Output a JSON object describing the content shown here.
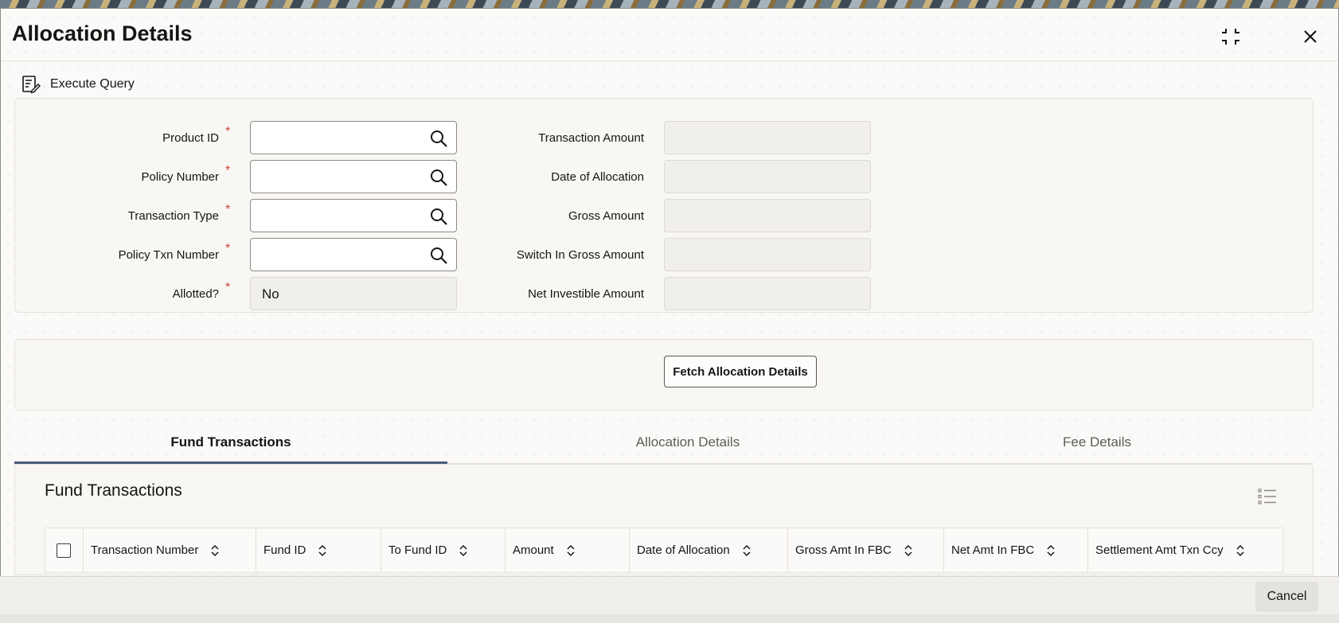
{
  "window": {
    "title": "Allocation Details"
  },
  "toolbar": {
    "execute_query_label": "Execute Query"
  },
  "form": {
    "product_id": {
      "label": "Product ID",
      "required": "*",
      "value": ""
    },
    "policy_number": {
      "label": "Policy Number",
      "required": "*",
      "value": ""
    },
    "transaction_type": {
      "label": "Transaction Type",
      "required": "*",
      "value": ""
    },
    "policy_txn_number": {
      "label": "Policy Txn Number",
      "required": "*",
      "value": ""
    },
    "allotted": {
      "label": "Allotted?",
      "required": "*",
      "value": "No"
    },
    "transaction_amount": {
      "label": "Transaction Amount",
      "value": ""
    },
    "date_of_allocation": {
      "label": "Date of Allocation",
      "value": ""
    },
    "gross_amount": {
      "label": "Gross Amount",
      "value": ""
    },
    "switch_in_gross_amount": {
      "label": "Switch In Gross Amount",
      "value": ""
    },
    "net_investible_amount": {
      "label": "Net Investible Amount",
      "value": ""
    }
  },
  "fetch_button_label": "Fetch Allocation Details",
  "tabs": [
    {
      "label": "Fund Transactions",
      "active": true
    },
    {
      "label": "Allocation Details",
      "active": false
    },
    {
      "label": "Fee Details",
      "active": false
    }
  ],
  "grid": {
    "title": "Fund Transactions",
    "columns": [
      "Transaction Number",
      "Fund ID",
      "To Fund ID",
      "Amount",
      "Date of Allocation",
      "Gross Amt In FBC",
      "Net Amt In FBC",
      "Settlement Amt Txn Ccy"
    ],
    "rows": []
  },
  "footer": {
    "cancel_label": "Cancel"
  },
  "colors": {
    "required": "#c74634",
    "active_tab_underline": "#4a5a79"
  },
  "icons": {
    "maximize": "maximize-icon",
    "close": "close-icon",
    "execute_query": "execute-query-icon",
    "lookup": "search-icon",
    "sort": "sort-icon",
    "grid_options": "list-settings-icon"
  }
}
